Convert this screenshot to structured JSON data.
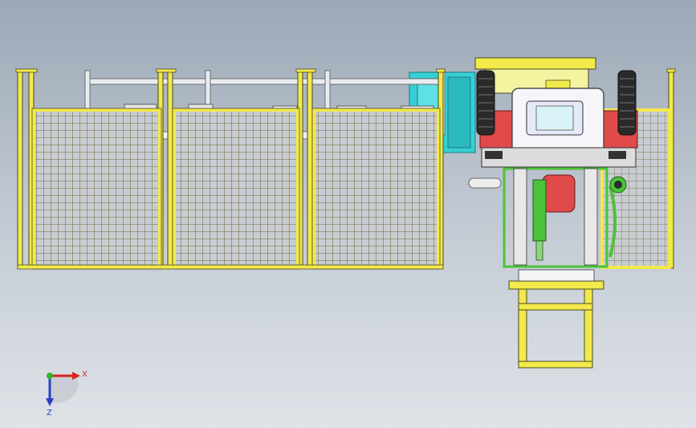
{
  "viewport": {
    "background_top": "#9ba8b6",
    "background_bottom": "#dfe3e8"
  },
  "model": {
    "fence_color": "#f2e94a",
    "mesh_color": "#6f6a3a",
    "rail_color": "#e8ecf0",
    "cab_color": "#f5f5fa",
    "accent_red": "#e04a4a",
    "accent_cyan": "#35d0d6",
    "hydraulic_green": "#4cc23a",
    "tire_color": "#2a2a2a",
    "fence_panel_count": 4
  },
  "triad": {
    "x_label": "X",
    "z_label": "Z",
    "x_color": "#d8241c",
    "y_color": "#2fb52a",
    "z_color": "#2a3fc4"
  }
}
